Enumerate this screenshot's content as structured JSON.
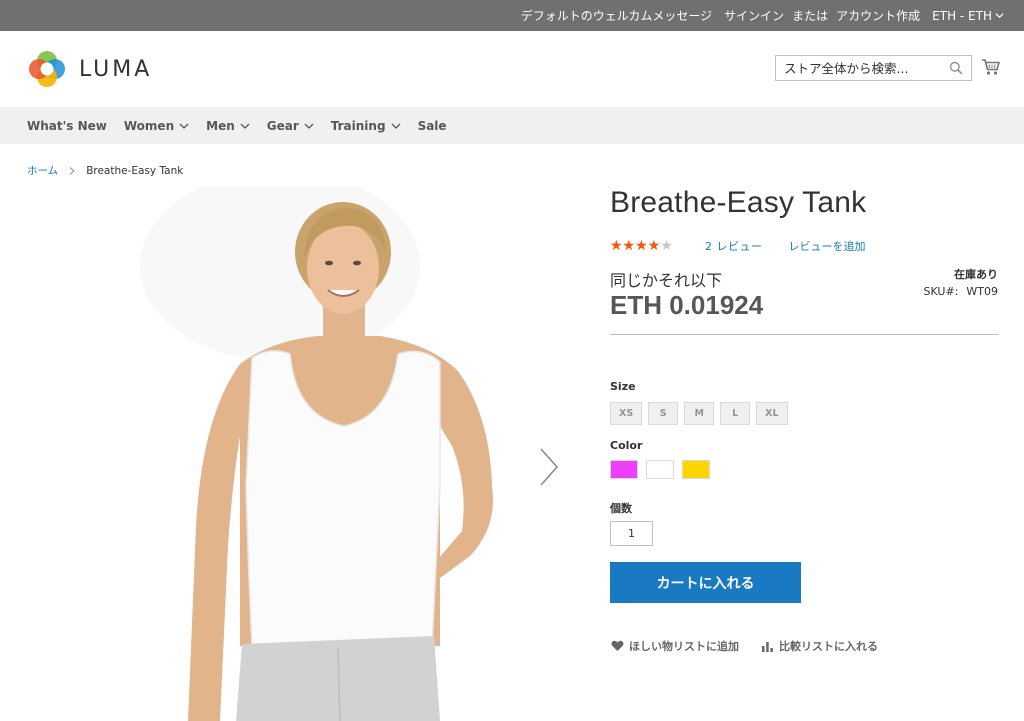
{
  "topbar": {
    "welcome": "デフォルトのウェルカムメッセージ",
    "sign_in": "サインイン",
    "or": "または",
    "create_account": "アカウント作成",
    "currency": "ETH - ETH"
  },
  "header": {
    "logo_text": "LUMA",
    "search_placeholder": "ストア全体から検索...",
    "search_value": ""
  },
  "nav": {
    "items": [
      {
        "label": "What's New",
        "has_dropdown": false
      },
      {
        "label": "Women",
        "has_dropdown": true
      },
      {
        "label": "Men",
        "has_dropdown": true
      },
      {
        "label": "Gear",
        "has_dropdown": true
      },
      {
        "label": "Training",
        "has_dropdown": true
      },
      {
        "label": "Sale",
        "has_dropdown": false
      }
    ]
  },
  "breadcrumb": {
    "home": "ホーム",
    "current": "Breathe-Easy Tank"
  },
  "product": {
    "title": "Breathe-Easy Tank",
    "rating_fraction": 0.7,
    "review_count_label": "2 レビュー",
    "add_review_label": "レビューを追加",
    "price_label": "同じかそれ以下",
    "price": "ETH 0.01924",
    "stock": "在庫あり",
    "sku_label": "SKU#:",
    "sku_value": "WT09"
  },
  "options": {
    "size_label": "Size",
    "sizes": [
      "XS",
      "S",
      "M",
      "L",
      "XL"
    ],
    "color_label": "Color",
    "colors": [
      "#ef3dff",
      "#ffffff",
      "#ffd500"
    ],
    "qty_label": "個数",
    "qty_value": "1"
  },
  "actions": {
    "add_to_cart": "カートに入れる",
    "wishlist": "ほしい物リストに追加",
    "compare": "比較リストに入れる"
  },
  "colors": {
    "topbar_bg": "#6e716e",
    "nav_bg": "#f0f0f0",
    "link": "#1979c3",
    "primary_button": "#1979c3",
    "star": "#ff5501"
  }
}
